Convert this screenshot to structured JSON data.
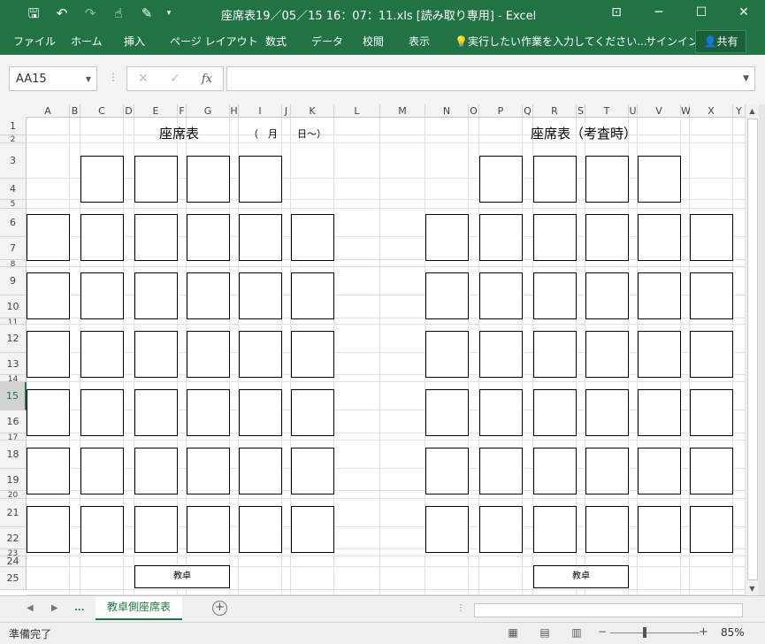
{
  "window": {
    "title": "座席表19／05／15 16：07：11.xls  [読み取り専用] - Excel",
    "qat": [
      "save-icon",
      "undo-icon",
      "redo-icon",
      "touch-mode-icon",
      "draw-icon",
      "customize-icon"
    ]
  },
  "ribbon": {
    "tabs": [
      "ファイル",
      "ホーム",
      "挿入",
      "ページ レイアウト",
      "数式",
      "データ",
      "校閲",
      "表示",
      "実行したい作業を入力してください...",
      "サインイン"
    ],
    "share": "共有"
  },
  "formula_bar": {
    "name_box": "AA15",
    "formula": ""
  },
  "columns": [
    "A",
    "B",
    "C",
    "D",
    "E",
    "F",
    "G",
    "H",
    "I",
    "J",
    "K",
    "L",
    "M",
    "N",
    "O",
    "P",
    "Q",
    "R",
    "S",
    "T",
    "U",
    "V",
    "W",
    "X",
    "Y"
  ],
  "rows": [
    "1",
    "2",
    "3",
    "4",
    "5",
    "6",
    "7",
    "8",
    "9",
    "10",
    "11",
    "12",
    "13",
    "14",
    "15",
    "16",
    "17",
    "18",
    "19",
    "20",
    "21",
    "22",
    "23",
    "24",
    "25"
  ],
  "selected_row": "15",
  "sheet_content": {
    "title_left": "座席表",
    "date_label": "（　月　　日～）",
    "title_right": "座席表（考査時）",
    "desk_left": "教卓",
    "desk_right": "教卓"
  },
  "sheet_tabs": {
    "more": "...",
    "active": "教卓側座席表"
  },
  "status": {
    "ready": "準備完了",
    "zoom": "85%"
  }
}
